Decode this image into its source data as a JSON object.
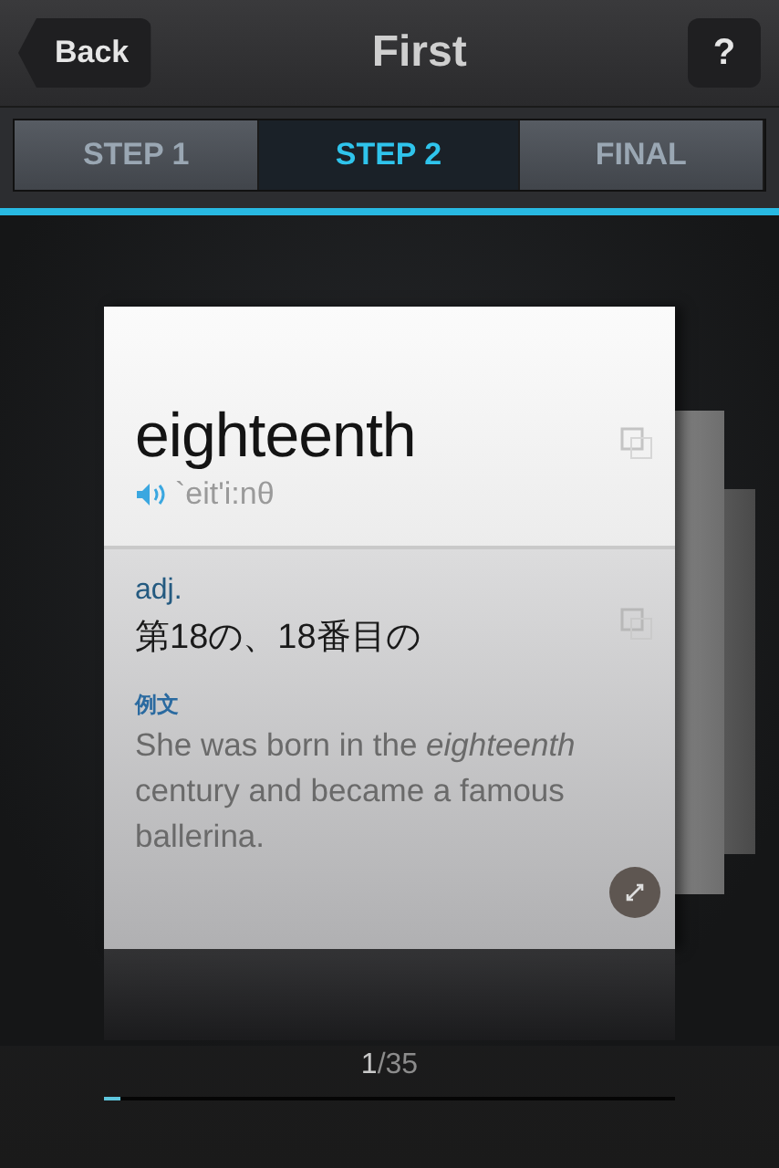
{
  "nav": {
    "back": "Back",
    "title": "First",
    "help": "?"
  },
  "tabs": [
    {
      "label": "STEP 1",
      "selected": false
    },
    {
      "label": "STEP 2",
      "selected": true
    },
    {
      "label": "FINAL",
      "selected": false
    }
  ],
  "card": {
    "word": "eighteenth",
    "pronunciation": "`eit'i:nθ",
    "part_of_speech": "adj.",
    "meaning": "第18の、18番目の",
    "example_label": "例文",
    "example": "She was born in the *eighteenth* century and became a famous ballerina."
  },
  "counter": {
    "current": "1",
    "rest": "/35"
  },
  "progress": {
    "level": 0.03
  }
}
